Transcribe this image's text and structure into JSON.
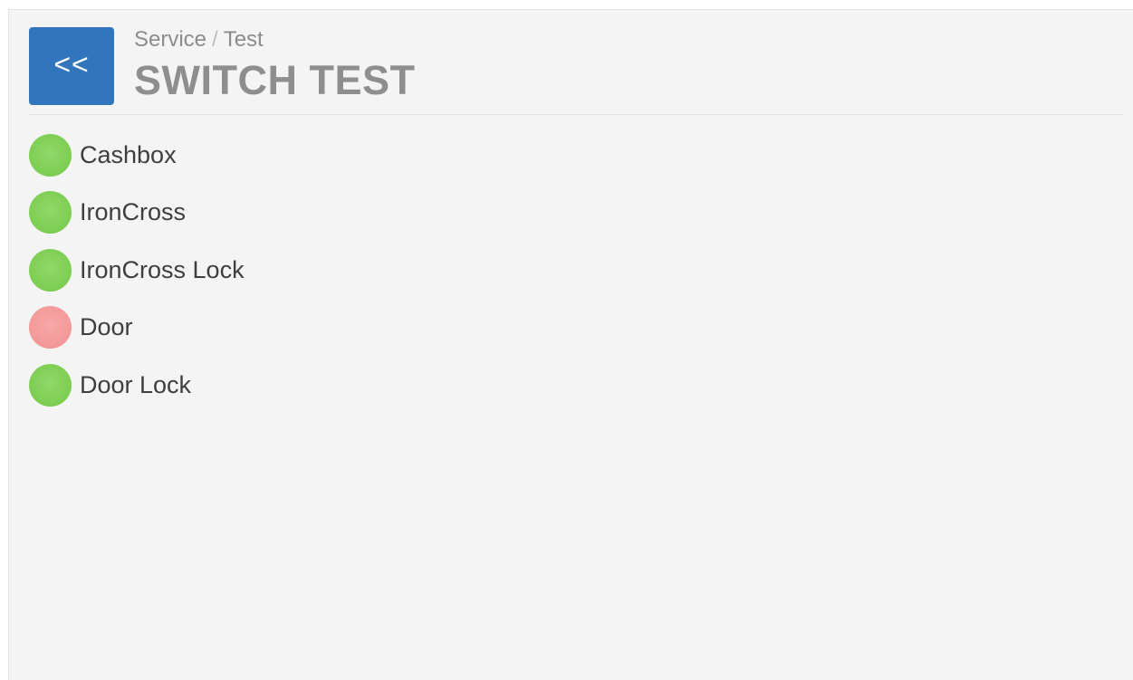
{
  "header": {
    "back_label": "<<",
    "breadcrumb": [
      "Service",
      "Test"
    ],
    "breadcrumb_separator": "/",
    "title": "SWITCH TEST"
  },
  "colors": {
    "accent": "#3176bd",
    "status_on": "#80cf55",
    "status_off": "#f49a9a"
  },
  "switches": [
    {
      "label": "Cashbox",
      "state": "on"
    },
    {
      "label": "IronCross",
      "state": "on"
    },
    {
      "label": "IronCross Lock",
      "state": "on"
    },
    {
      "label": "Door",
      "state": "off"
    },
    {
      "label": "Door Lock",
      "state": "on"
    }
  ]
}
